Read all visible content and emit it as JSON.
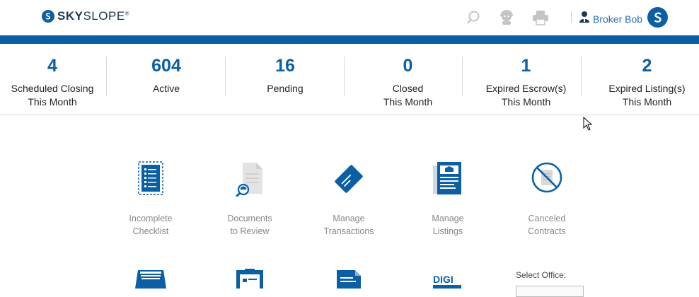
{
  "brand": {
    "name_bold": "SKY",
    "name_thin": "SLOPE",
    "mark": "®"
  },
  "header": {
    "icons": [
      "search-icon",
      "support-agent-icon",
      "print-icon"
    ],
    "user_name": "Broker Bob",
    "avatar_letter": "S"
  },
  "stats": [
    {
      "value": "4",
      "label": "Scheduled Closing\nThis Month"
    },
    {
      "value": "604",
      "label": "Active"
    },
    {
      "value": "16",
      "label": "Pending"
    },
    {
      "value": "0",
      "label": "Closed\nThis Month"
    },
    {
      "value": "1",
      "label": "Expired Escrow(s)\nThis Month"
    },
    {
      "value": "2",
      "label": "Expired Listing(s)\nThis Month"
    }
  ],
  "tiles": [
    {
      "label": "Incomplete\nChecklist",
      "icon": "checklist-icon"
    },
    {
      "label": "Documents\nto Review",
      "icon": "document-review-icon"
    },
    {
      "label": "Manage\nTransactions",
      "icon": "transaction-card-icon"
    },
    {
      "label": "Manage\nListings",
      "icon": "listing-icon"
    },
    {
      "label": "Canceled\nContracts",
      "icon": "canceled-contract-icon"
    }
  ],
  "bottom_tiles": [
    "inbox-tray-icon",
    "clipboard-icon",
    "document-icon",
    "digisign-icon"
  ],
  "digisign_text": "DIGI",
  "office": {
    "label": "Select Office:"
  },
  "colors": {
    "brand_blue": "#0b5fa5",
    "link_blue": "#2a6bb5",
    "muted_grey": "#888888"
  }
}
